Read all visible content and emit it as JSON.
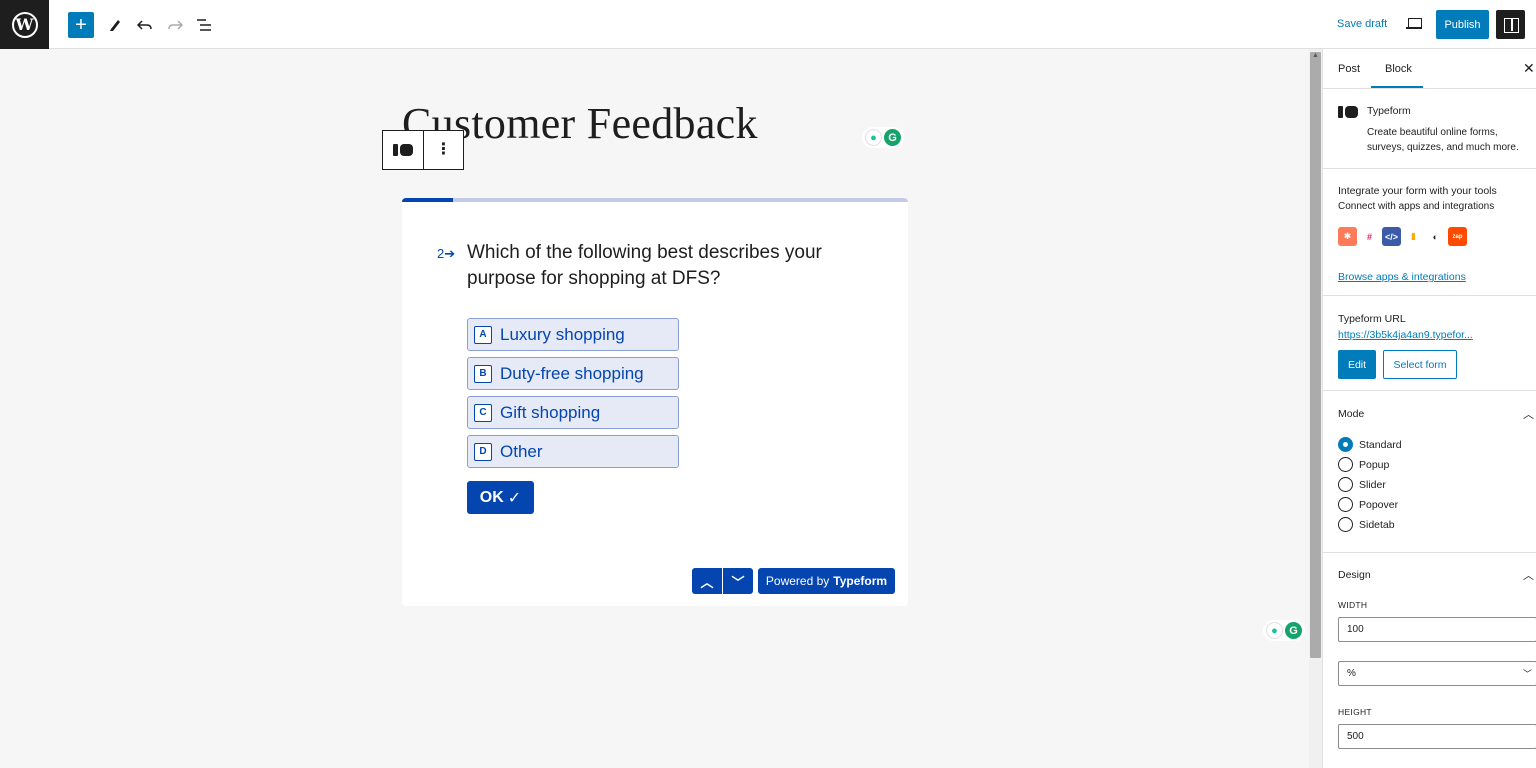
{
  "topbar": {
    "logo": "W",
    "add_icon": "+",
    "save_draft": "Save draft",
    "publish": "Publish"
  },
  "editor": {
    "post_title": "Customer Feedback",
    "toolbar_more": "⋮"
  },
  "typeform_embed": {
    "question_number": "2",
    "question_text": "Which of the following best describes your purpose for shopping at DFS?",
    "choices": [
      {
        "key": "A",
        "label": "Luxury shopping"
      },
      {
        "key": "B",
        "label": "Duty-free shopping"
      },
      {
        "key": "C",
        "label": "Gift shopping"
      },
      {
        "key": "D",
        "label": "Other"
      }
    ],
    "ok_label": "OK",
    "powered_by": "Powered by",
    "brand": "Typeform",
    "progress_fraction": 0.1,
    "accent_color": "#0445af"
  },
  "sidebar": {
    "tabs": [
      "Post",
      "Block"
    ],
    "active_tab": "Block",
    "block_name": "Typeform",
    "block_description": "Create beautiful online forms, surveys, quizzes, and much more.",
    "integrate_title": "Integrate your form with your tools",
    "integrate_sub": "Connect with apps and integrations",
    "browse_link": "Browse apps & integrations",
    "url_title": "Typeform URL",
    "url_value": "https://3b5k4ja4an9.typefor...",
    "edit_label": "Edit",
    "select_form_label": "Select form",
    "mode_title": "Mode",
    "modes": [
      "Standard",
      "Popup",
      "Slider",
      "Popover",
      "Sidetab"
    ],
    "selected_mode": "Standard",
    "design_title": "Design",
    "width_label": "WIDTH",
    "width_value": "100",
    "unit_value": "%",
    "height_label": "HEIGHT",
    "height_value": "500"
  }
}
